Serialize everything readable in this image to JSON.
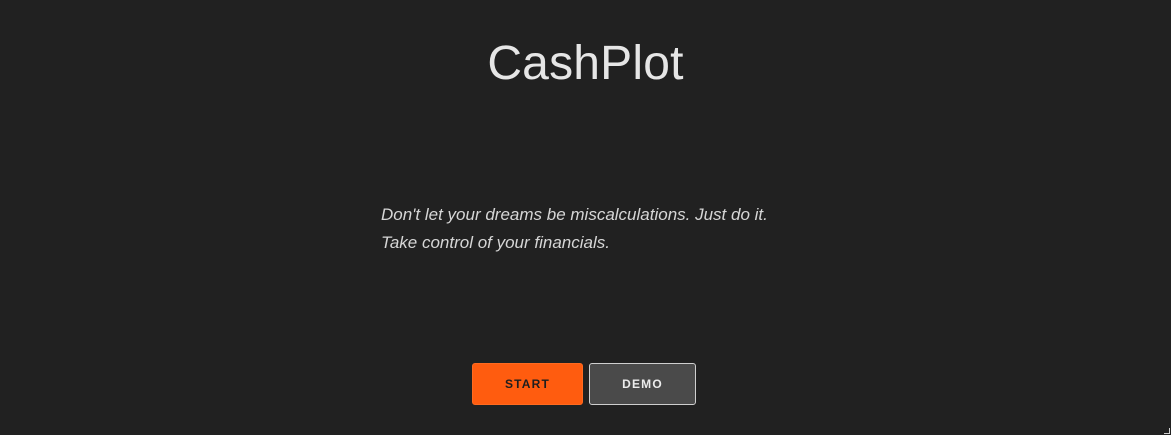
{
  "app": {
    "title": "CashPlot"
  },
  "hero": {
    "tagline_line1": "Don't let your dreams be miscalculations. Just do it.",
    "tagline_line2": "Take control of your financials."
  },
  "actions": {
    "start_label": "START",
    "demo_label": "DEMO"
  },
  "colors": {
    "background": "#212121",
    "accent": "#ff5c0f",
    "secondary_button": "#4a4a4a",
    "text": "#e6e6e6"
  }
}
